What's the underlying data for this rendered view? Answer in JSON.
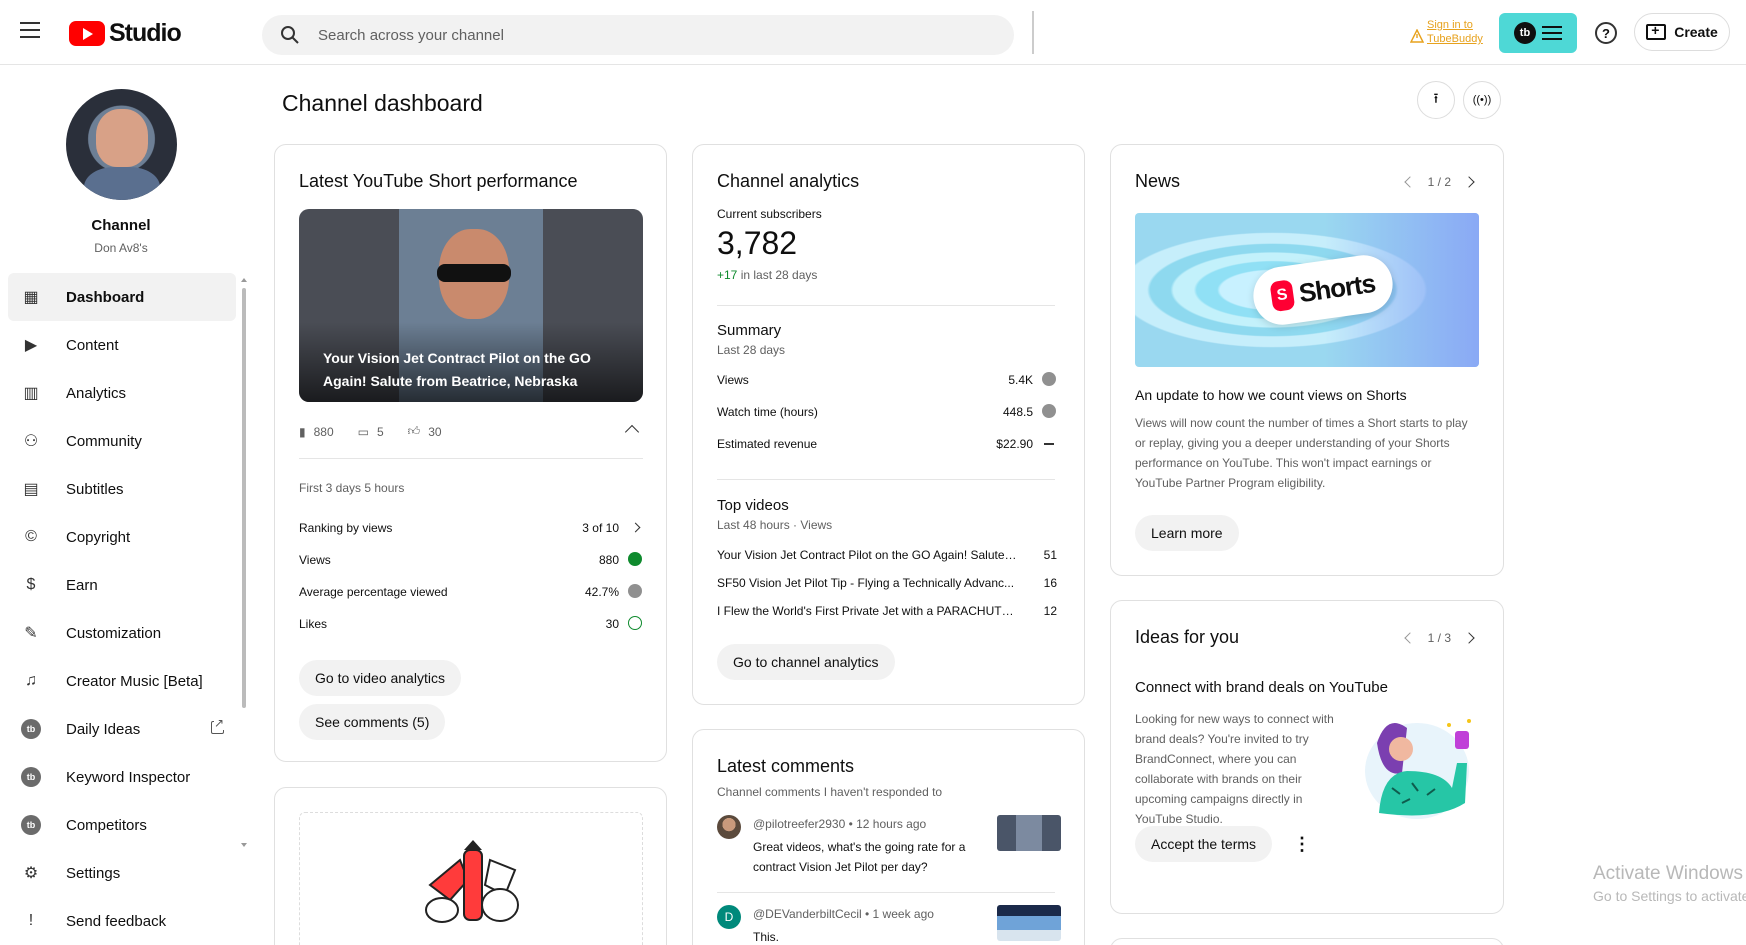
{
  "header": {
    "logo_text": "Studio",
    "search_placeholder": "Search across your channel",
    "tubebuddy_signin": "Sign in to",
    "tubebuddy_signin2": "TubeBuddy",
    "tubebuddy_badge": "tb",
    "help_icon": "?",
    "create_label": "Create"
  },
  "sidebar": {
    "channel_label": "Channel",
    "channel_name": "Don Av8's",
    "items": [
      {
        "label": "Dashboard",
        "icon": "dashboard-icon",
        "glyph": "▦"
      },
      {
        "label": "Content",
        "icon": "content-icon",
        "glyph": "▶"
      },
      {
        "label": "Analytics",
        "icon": "analytics-icon",
        "glyph": "▥"
      },
      {
        "label": "Community",
        "icon": "community-icon",
        "glyph": "⚇"
      },
      {
        "label": "Subtitles",
        "icon": "subtitles-icon",
        "glyph": "▤"
      },
      {
        "label": "Copyright",
        "icon": "copyright-icon",
        "glyph": "©"
      },
      {
        "label": "Earn",
        "icon": "earn-icon",
        "glyph": "$"
      },
      {
        "label": "Customization",
        "icon": "customization-icon",
        "glyph": "✎"
      },
      {
        "label": "Creator Music [Beta]",
        "icon": "music-icon",
        "glyph": "♫"
      },
      {
        "label": "Daily Ideas",
        "icon": "tubebuddy-icon",
        "glyph": "tb"
      },
      {
        "label": "Keyword Inspector",
        "icon": "tubebuddy-icon",
        "glyph": "tb"
      },
      {
        "label": "Competitors",
        "icon": "tubebuddy-icon",
        "glyph": "tb"
      },
      {
        "label": "Settings",
        "icon": "settings-icon",
        "glyph": "⚙"
      },
      {
        "label": "Send feedback",
        "icon": "feedback-icon",
        "glyph": "!"
      }
    ]
  },
  "main": {
    "page_title": "Channel dashboard",
    "upload_glyph": "⭱",
    "live_glyph": "((•))"
  },
  "short_card": {
    "title": "Latest YouTube Short performance",
    "video_title": "Your Vision Jet Contract Pilot on the GO Again! Salute from Beatrice, Nebraska",
    "views_count": "880",
    "comments_count": "5",
    "likes_count": "30",
    "period": "First 3 days 5 hours",
    "rows": [
      {
        "label": "Ranking by views",
        "value": "3 of 10"
      },
      {
        "label": "Views",
        "value": "880"
      },
      {
        "label": "Average percentage viewed",
        "value": "42.7%"
      },
      {
        "label": "Likes",
        "value": "30"
      }
    ],
    "btn_analytics": "Go to video analytics",
    "btn_comments": "See comments (5)"
  },
  "analytics_card": {
    "title": "Channel analytics",
    "subs_label": "Current subscribers",
    "subs_value": "3,782",
    "subs_delta": "+17",
    "subs_delta_suffix": " in last 28 days",
    "summary_title": "Summary",
    "summary_period": "Last 28 days",
    "summary_rows": [
      {
        "label": "Views",
        "value": "5.4K"
      },
      {
        "label": "Watch time (hours)",
        "value": "448.5"
      },
      {
        "label": "Estimated revenue",
        "value": "$22.90"
      }
    ],
    "top_title": "Top videos",
    "top_period": "Last 48 hours · Views",
    "top_videos": [
      {
        "title": "Your Vision Jet Contract Pilot on the GO Again! Salute ...",
        "views": "51"
      },
      {
        "title": "SF50 Vision Jet Pilot Tip - Flying a Technically Advanc...",
        "views": "16"
      },
      {
        "title": "I Flew the World's First Private Jet with a PARACHUTE ...",
        "views": "12"
      }
    ],
    "btn": "Go to channel analytics"
  },
  "news_card": {
    "title": "News",
    "pager": "1 / 2",
    "shorts_word": "Shorts",
    "shorts_glyph": "S",
    "headline": "An update to how we count views on Shorts",
    "body": "Views will now count the number of times a Short starts to play or replay, giving you a deeper understanding of your Shorts performance on YouTube. This won't impact earnings or YouTube Partner Program eligibility.",
    "btn": "Learn more"
  },
  "ideas_card": {
    "title": "Ideas for you",
    "pager": "1 / 3",
    "headline": "Connect with brand deals on YouTube",
    "body": "Looking for new ways to connect with brand deals? You're invited to try BrandConnect, where you can collaborate with brands on their upcoming campaigns directly in YouTube Studio.",
    "btn": "Accept the terms",
    "more_glyph": "⋮"
  },
  "comments_card": {
    "title": "Latest comments",
    "subtitle": "Channel comments I haven't responded to",
    "comments": [
      {
        "author": "@pilotreefer2930",
        "time": "12 hours ago",
        "text": "Great videos, what's the going rate for a contract Vision Jet Pilot per day?"
      },
      {
        "author": "@DEVanderbiltCecil",
        "time": "1 week ago",
        "text": "This.",
        "avatar_letter": "D"
      }
    ]
  },
  "watermark": {
    "line1": "Activate Windows",
    "line2": "Go to Settings to activate Windows."
  }
}
